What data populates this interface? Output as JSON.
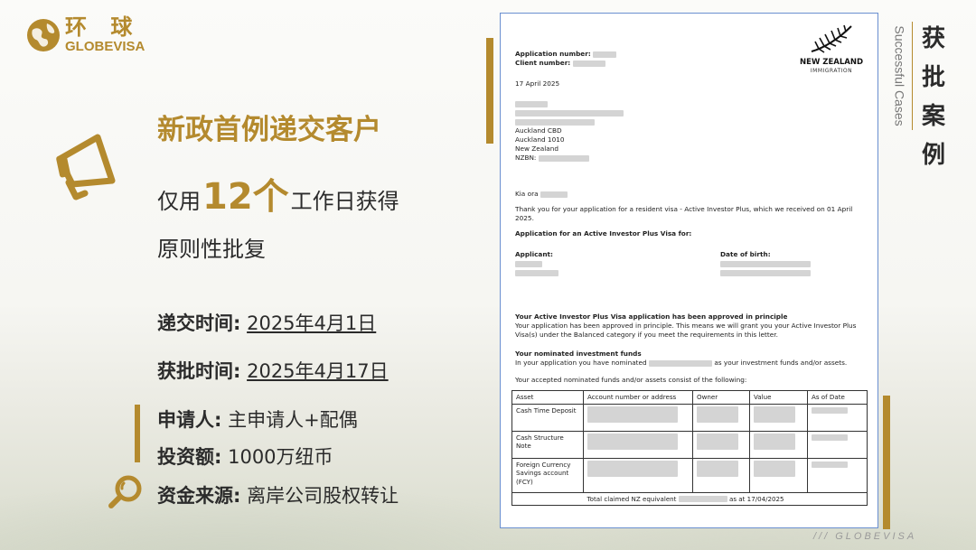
{
  "logo": {
    "cn": "环 球",
    "en": "GLOBEVISA"
  },
  "headline": "新政首例递交客户",
  "line2": {
    "pre": "仅用",
    "big": "12个",
    "post": "工作日获得"
  },
  "line3": "原则性批复",
  "submit": {
    "label": "递交时间:",
    "value": "2025年4月1日"
  },
  "approve": {
    "label": "获批时间:",
    "value": "2025年4月17日"
  },
  "applicant": {
    "label": "申请人:",
    "value": "主申请人+配偶"
  },
  "investment": {
    "label": "投资额:",
    "value": "1000万纽币"
  },
  "funds": {
    "label": "资金来源:",
    "value": "离岸公司股权转让"
  },
  "sidebar": {
    "en": "Successful Cases",
    "cn": [
      "获",
      "批",
      "案",
      "例"
    ]
  },
  "footer": "/// GLOBEVISA",
  "letter": {
    "app_no_label": "Application number:",
    "client_no_label": "Client number:",
    "date": "17 April 2025",
    "addr": [
      "Auckland CBD",
      "Auckland 1010",
      "New Zealand"
    ],
    "nzbn_label": "NZBN:",
    "greeting": "Kia ora",
    "thanks": "Thank you for your application for a resident visa - Active Investor Plus, which we received on 01 April 2025.",
    "app_for": "Application for an Active Investor Plus Visa for:",
    "applicant_label": "Applicant:",
    "dob_label": "Date of birth:",
    "approved_head": "Your Active Investor Plus Visa application has been approved in principle",
    "approved_body": "Your application has been approved in principle. This means we will grant you your Active Investor Plus Visa(s) under the Balanced category if you meet the requirements in this letter.",
    "funds_head": "Your nominated investment funds",
    "funds_body_pre": "In your application you have nominated",
    "funds_body_post": "as your investment funds and/or assets.",
    "accepted": "Your accepted nominated funds and/or assets consist of the following:",
    "nz_logo": {
      "title": "NEW ZEALAND",
      "sub": "IMMIGRATION"
    },
    "table": {
      "headers": [
        "Asset",
        "Account number or address",
        "Owner",
        "Value",
        "As of Date"
      ],
      "rows": [
        [
          "Cash Time Deposit"
        ],
        [
          "Cash Structure Note"
        ],
        [
          "Foreign Currency Savings account (FCY)"
        ]
      ],
      "total_pre": "Total claimed NZ equivalent",
      "total_post": "as at 17/04/2025"
    }
  }
}
